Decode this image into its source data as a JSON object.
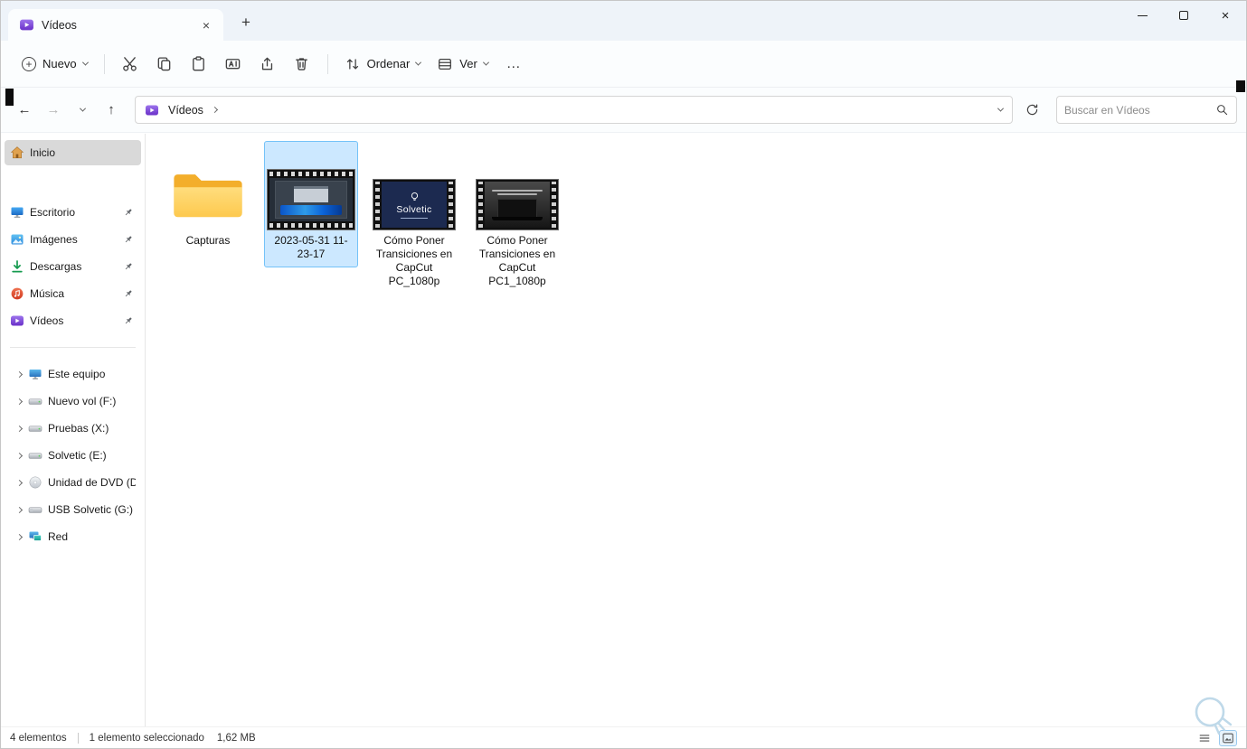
{
  "window": {
    "tab_title": "Vídeos"
  },
  "icons": {
    "close": "×",
    "plus": "+",
    "back": "←",
    "forward": "→",
    "up": "↑",
    "more": "…"
  },
  "toolbar": {
    "new_label": "Nuevo",
    "sort_label": "Ordenar",
    "view_label": "Ver"
  },
  "addressbar": {
    "breadcrumb_root": "Vídeos",
    "search_placeholder": "Buscar en Vídeos"
  },
  "sidebar": {
    "items": [
      {
        "label": "Inicio"
      },
      {
        "label": "Escritorio"
      },
      {
        "label": "Imágenes"
      },
      {
        "label": "Descargas"
      },
      {
        "label": "Música"
      },
      {
        "label": "Vídeos"
      },
      {
        "label": "Este equipo"
      },
      {
        "label": "Nuevo vol (F:)"
      },
      {
        "label": "Pruebas (X:)"
      },
      {
        "label": "Solvetic (E:)"
      },
      {
        "label": "Unidad de DVD (D:)"
      },
      {
        "label": "USB Solvetic (G:)"
      },
      {
        "label": "Red"
      }
    ]
  },
  "files": [
    {
      "name": "Capturas",
      "type": "folder"
    },
    {
      "name": "2023-05-31 11-23-17",
      "type": "video",
      "selected": true
    },
    {
      "name": "Cómo Poner Transiciones en CapCut PC_1080p",
      "type": "video"
    },
    {
      "name": "Cómo Poner Transiciones en CapCut PC1_1080p",
      "type": "video"
    }
  ],
  "thumbnails": {
    "solvetic_logo_text": "Solvetic"
  },
  "statusbar": {
    "item_count": "4 elementos",
    "selection": "1 elemento seleccionado",
    "size": "1,62 MB"
  }
}
